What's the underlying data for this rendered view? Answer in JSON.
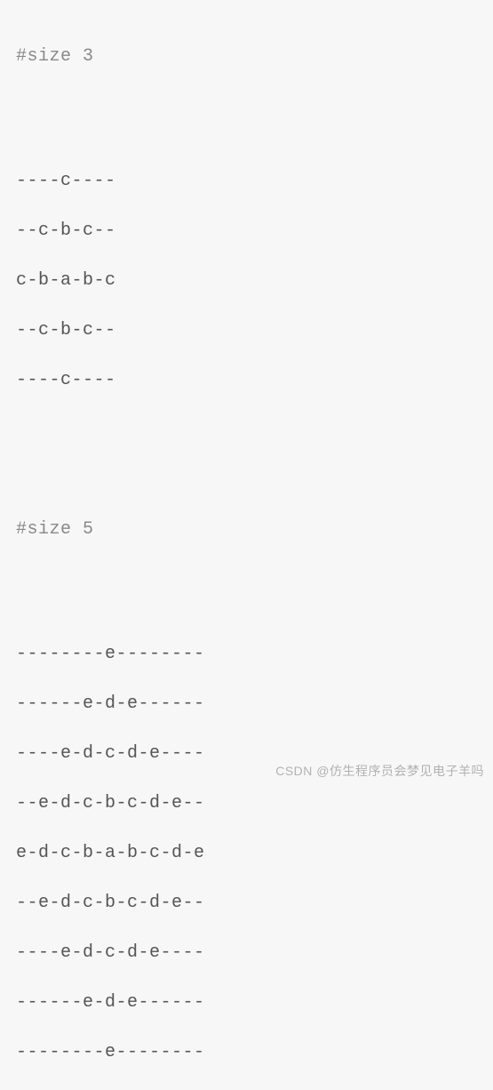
{
  "block": {
    "comment1": "#size 3",
    "pattern3": [
      "----c----",
      "--c-b-c--",
      "c-b-a-b-c",
      "--c-b-c--",
      "----c----"
    ],
    "comment2": "#size 5",
    "pattern5": [
      "--------e--------",
      "------e-d-e------",
      "----e-d-c-d-e----",
      "--e-d-c-b-c-d-e--",
      "e-d-c-b-a-b-c-d-e",
      "--e-d-c-b-c-d-e--",
      "----e-d-c-d-e----",
      "------e-d-e------",
      "--------e--------"
    ]
  },
  "watermark": "CSDN @仿生程序员会梦见电子羊吗"
}
